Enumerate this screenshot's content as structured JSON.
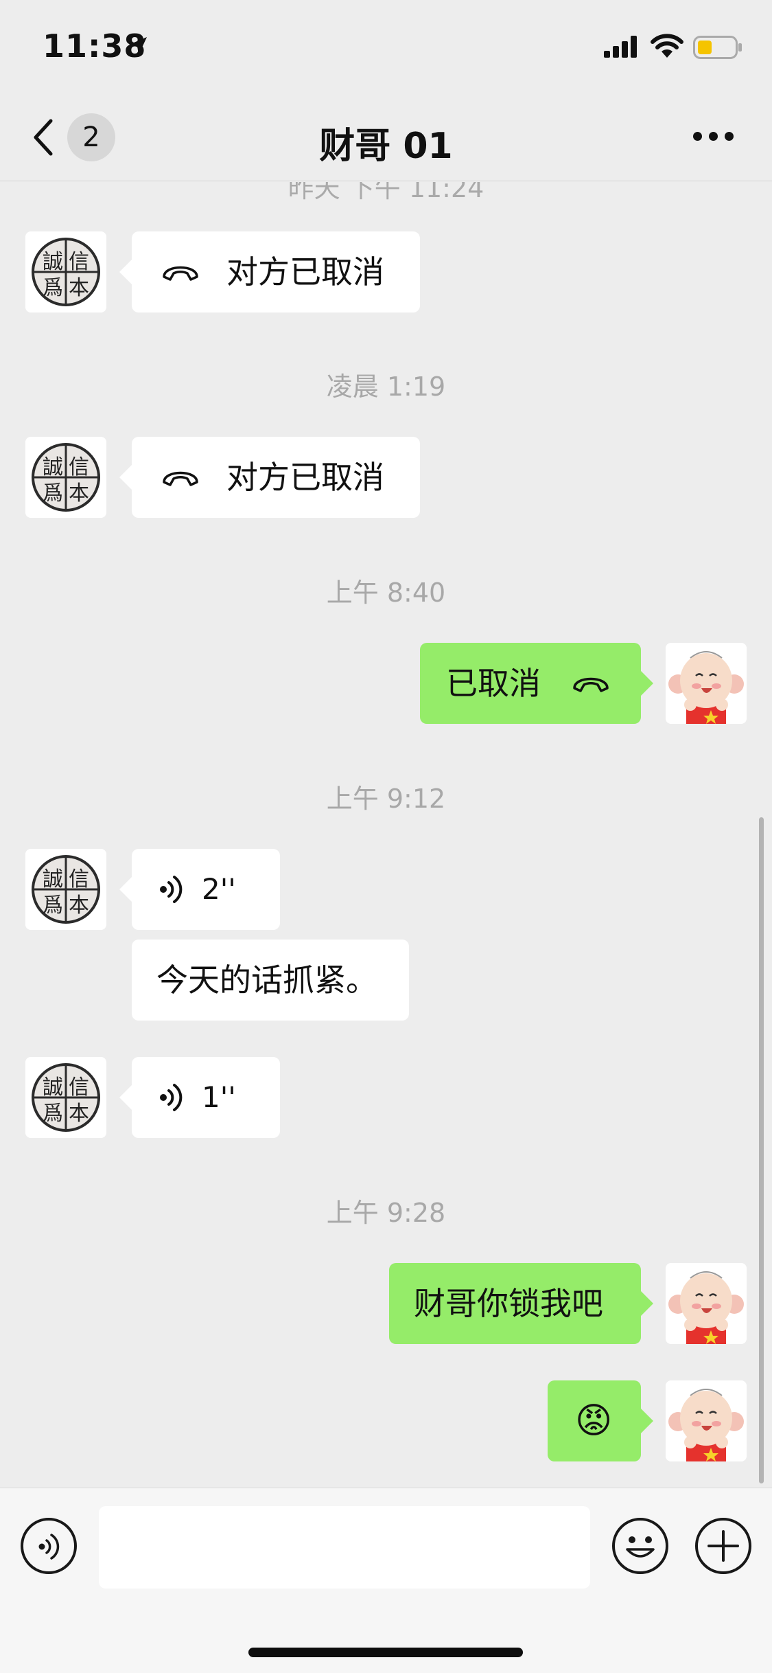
{
  "status_bar": {
    "time": "11:38"
  },
  "header": {
    "unread_count": "2",
    "title": "财哥 01"
  },
  "chat": {
    "cut_timestamp": "昨天 下午 11:24",
    "timestamps": [
      "凌晨 1:19",
      "上午 8:40",
      "上午 9:12",
      "上午 9:28"
    ],
    "messages": [
      {
        "side": "in",
        "type": "call",
        "text": "对方已取消"
      },
      {
        "side": "in",
        "type": "call",
        "text": "对方已取消"
      },
      {
        "side": "out",
        "type": "call",
        "text": "已取消"
      },
      {
        "side": "in",
        "type": "voice",
        "text": "2''"
      },
      {
        "side": "in",
        "type": "text",
        "text": "今天的话抓紧。"
      },
      {
        "side": "in",
        "type": "voice",
        "text": "1''"
      },
      {
        "side": "out",
        "type": "text",
        "text": "财哥你锁我吧"
      },
      {
        "side": "out",
        "type": "emoji",
        "text": "😡"
      }
    ],
    "contact_avatar_text": [
      "誠",
      "信",
      "爲",
      "本"
    ]
  },
  "input_bar": {
    "placeholder": ""
  },
  "icons": {
    "back": "chevron-left-icon",
    "more": "more-dots-icon",
    "call": "phone-hangup-icon",
    "voice": "voice-wave-icon",
    "emoji": "smiley-face-icon",
    "plus": "plus-circle-icon"
  },
  "colors": {
    "background": "#ededed",
    "outgoing_bubble": "#95ec69",
    "incoming_bubble": "#ffffff",
    "timestamp": "#a8a8a8"
  }
}
